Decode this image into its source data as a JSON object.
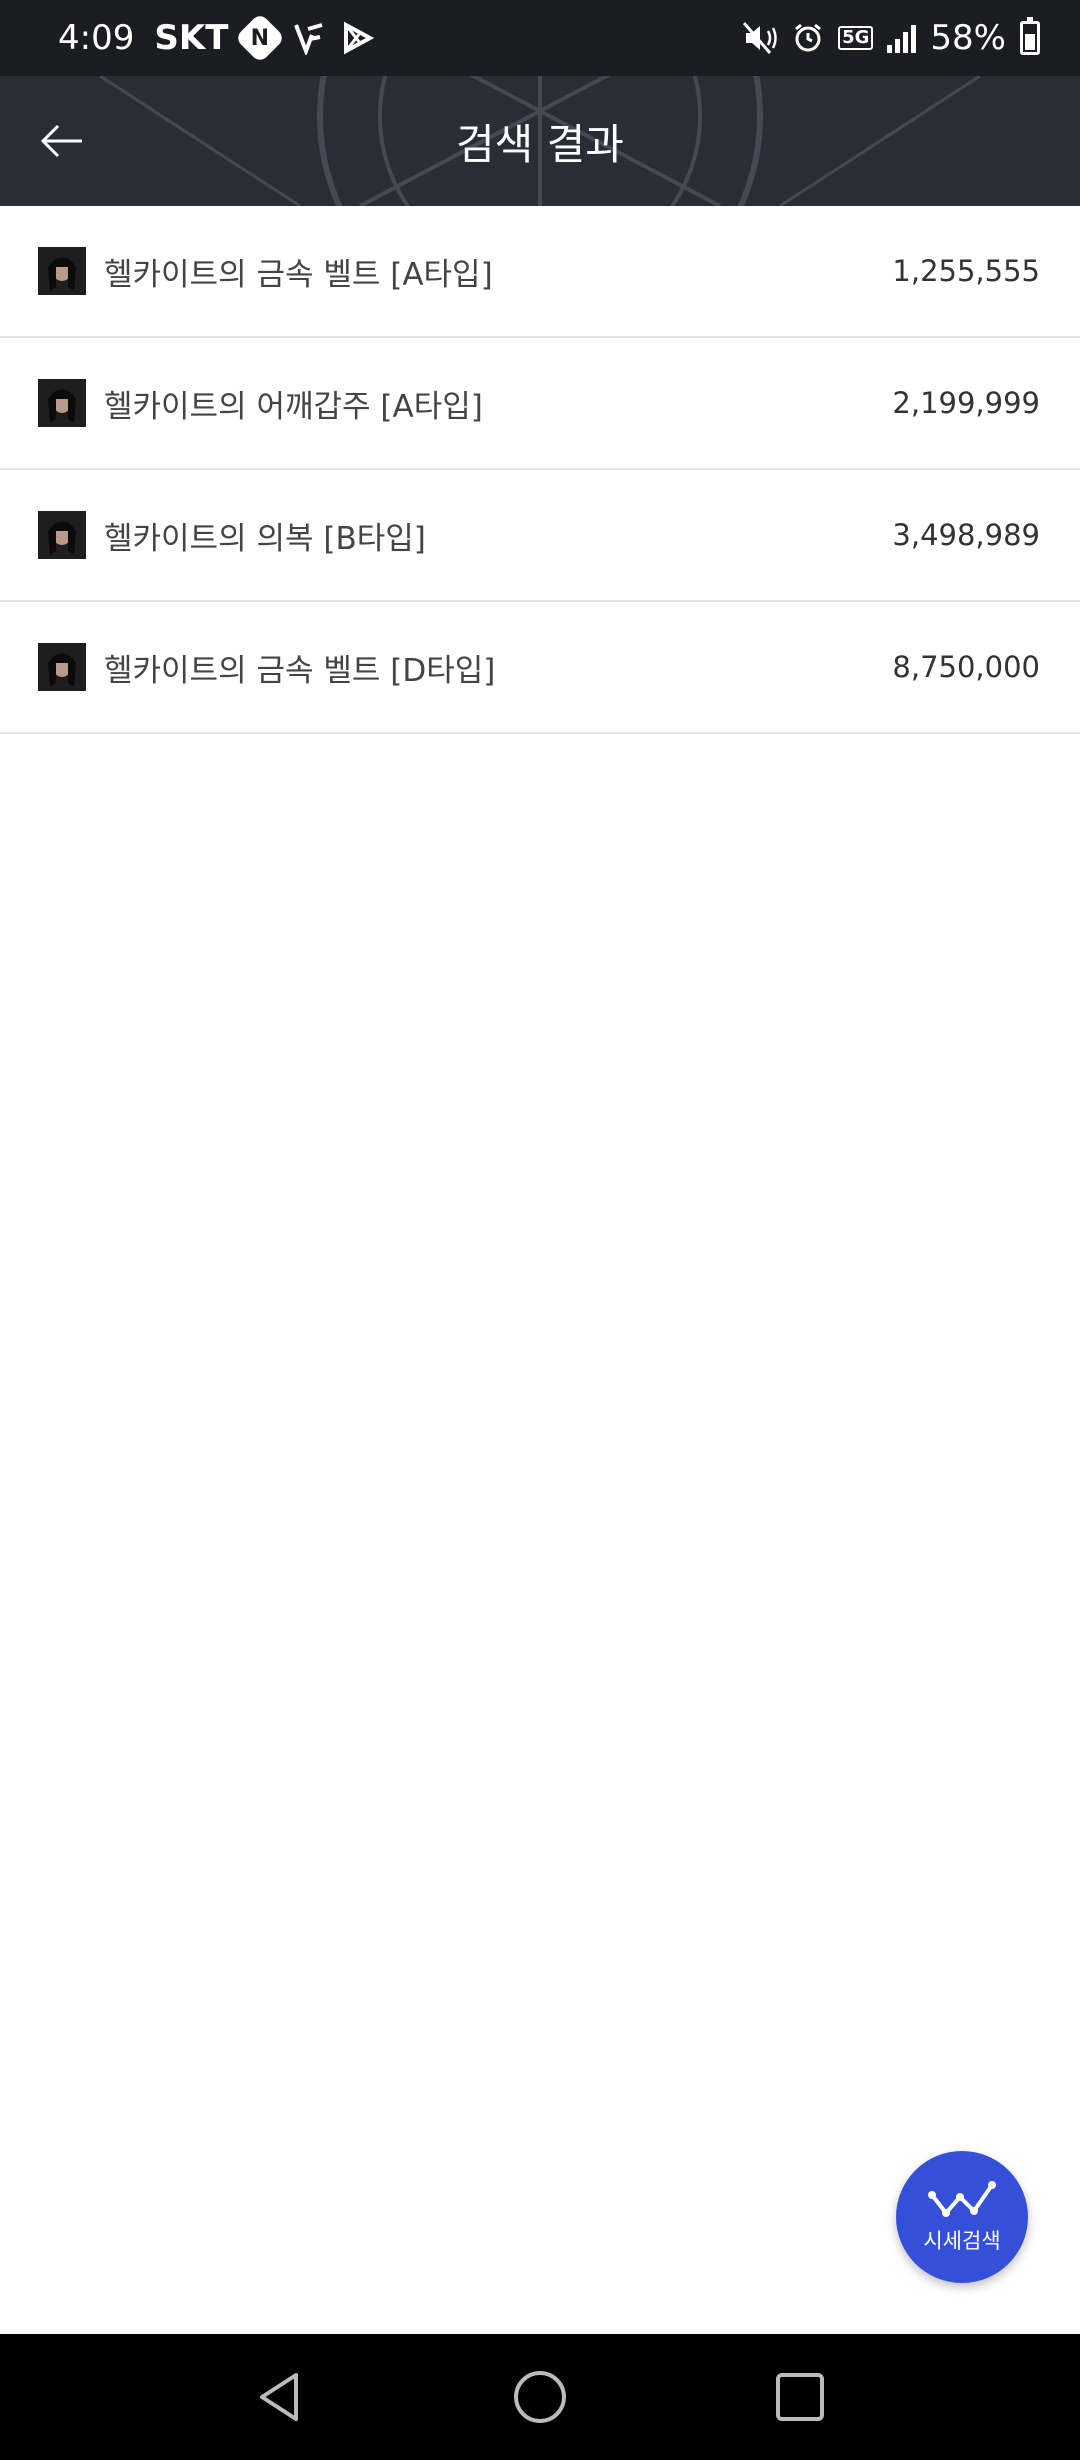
{
  "status_bar": {
    "time": "4:09",
    "carrier": "SKT",
    "network": "5G",
    "battery": "58%",
    "icons": [
      "naver-icon",
      "v-app-icon",
      "play-store-icon",
      "mute-icon",
      "alarm-icon",
      "5g-icon",
      "signal-icon",
      "battery-icon"
    ]
  },
  "header": {
    "title": "검색 결과",
    "back_icon": "arrow-left-icon"
  },
  "results": [
    {
      "name": "헬카이트의 금속 벨트 [A타입]",
      "price": "1,255,555"
    },
    {
      "name": "헬카이트의 어깨갑주 [A타입]",
      "price": "2,199,999"
    },
    {
      "name": "헬카이트의 의복 [B타입]",
      "price": "3,498,989"
    },
    {
      "name": "헬카이트의 금속 벨트 [D타입]",
      "price": "8,750,000"
    }
  ],
  "fab": {
    "label": "시세검색",
    "icon": "trend-chart-icon",
    "color": "#3550d8"
  },
  "nav": {
    "icons": [
      "back-triangle-icon",
      "home-circle-icon",
      "recents-square-icon"
    ]
  }
}
